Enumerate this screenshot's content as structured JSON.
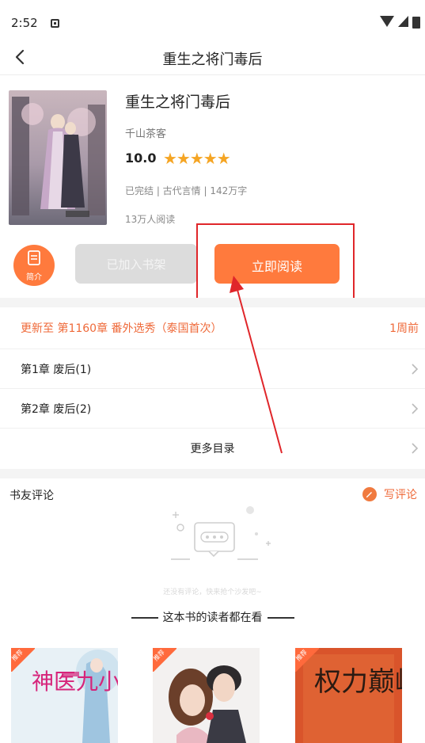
{
  "status_bar": {
    "time": "2:52"
  },
  "nav": {
    "title": "重生之将门毒后"
  },
  "book": {
    "title": "重生之将门毒后",
    "author": "千山茶客",
    "score": "10.0",
    "stars": "★★★★★",
    "star_color": "#f5a524",
    "meta": "已完结 | 古代言情 | 142万字",
    "readers": "13万人阅读"
  },
  "actions": {
    "intro_label": "简介",
    "shelf_label": "已加入书架",
    "read_label": "立即阅读",
    "accent_color": "#ff7a3d"
  },
  "catalog": {
    "update_label": "更新至 第1160章 番外选秀（泰国首次）",
    "update_time": "1周前",
    "chapters": [
      {
        "title": "第1章 废后(1)"
      },
      {
        "title": "第2章 废后(2)"
      }
    ],
    "more_label": "更多目录"
  },
  "comments": {
    "title": "书友评论",
    "write_label": "写评论",
    "empty_text": "还没有评论，快来抢个沙发吧~"
  },
  "recommendations": {
    "heading": "这本书的读者都在看",
    "books": [
      {
        "badge": "推荐",
        "cover_text": "神医九小姐"
      },
      {
        "badge": "推荐"
      },
      {
        "badge": "推荐",
        "cover_text": "权力巅峰"
      }
    ]
  }
}
